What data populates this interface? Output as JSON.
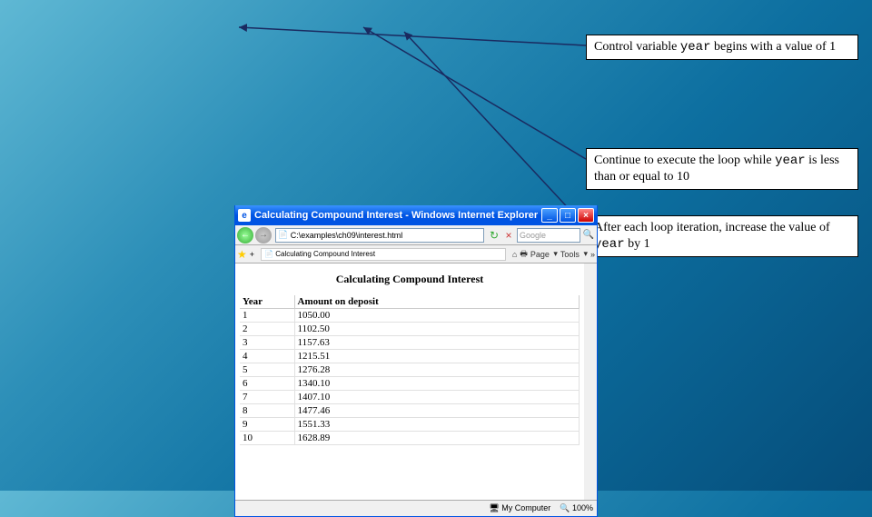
{
  "callouts": {
    "c1_pre": "Control variable ",
    "c1_code": "year",
    "c1_post": " begins with a value of 1",
    "c2_pre": "Continue to execute the loop while ",
    "c2_code": "year",
    "c2_post": " is less than or equal to 10",
    "c3_pre": "After each loop iteration, increase the value of ",
    "c3_code": "year",
    "c3_post": " by 1"
  },
  "ie": {
    "title": "Calculating Compound Interest - Windows Internet Explorer",
    "url": "C:\\examples\\ch09\\interest.html",
    "search_placeholder": "Google",
    "tab_label": "Calculating Compound Interest",
    "page_btn": "Page",
    "tools_btn": "Tools",
    "status_comp": "My Computer",
    "status_zoom": "100%",
    "min": "_",
    "max": "□",
    "cls": "×",
    "back": "←",
    "fwd": "→",
    "reload": "↻",
    "stop": "×",
    "go": "🔍",
    "star": "★",
    "plus": "+",
    "home": "⌂",
    "print": "🖶",
    "dd": "▾",
    "chev": "»",
    "up": "▲",
    "dn": "▼"
  },
  "page": {
    "heading": "Calculating Compound Interest",
    "col1": "Year",
    "col2": "Amount on deposit",
    "rows": [
      {
        "y": "1",
        "a": "1050.00"
      },
      {
        "y": "2",
        "a": "1102.50"
      },
      {
        "y": "3",
        "a": "1157.63"
      },
      {
        "y": "4",
        "a": "1215.51"
      },
      {
        "y": "5",
        "a": "1276.28"
      },
      {
        "y": "6",
        "a": "1340.10"
      },
      {
        "y": "7",
        "a": "1407.10"
      },
      {
        "y": "8",
        "a": "1477.46"
      },
      {
        "y": "9",
        "a": "1551.33"
      },
      {
        "y": "10",
        "a": "1628.89"
      }
    ]
  }
}
